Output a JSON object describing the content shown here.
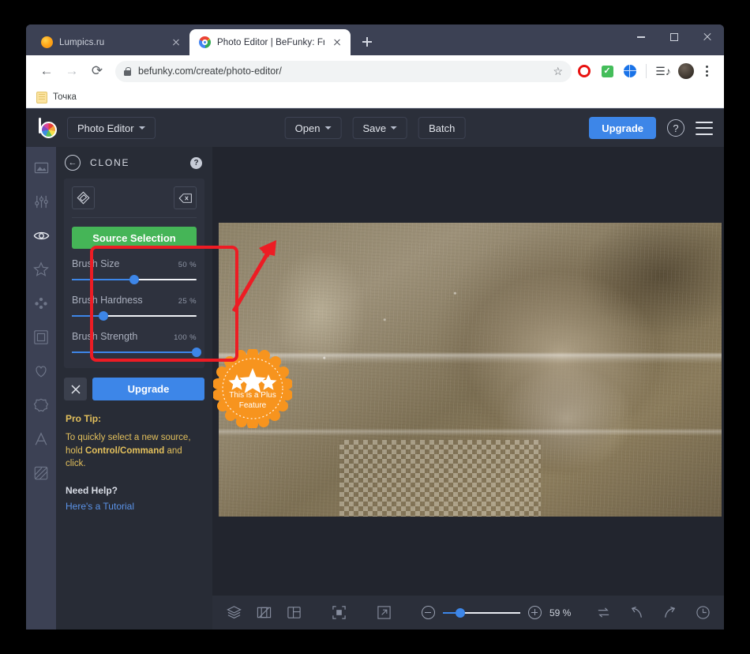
{
  "browser": {
    "tabs": [
      {
        "title": "Lumpics.ru",
        "favicon": "lumpics-favicon",
        "active": false
      },
      {
        "title": "Photo Editor | BeFunky: Free Onli",
        "favicon": "chrome-favicon",
        "active": true
      }
    ],
    "new_tab_label": "+",
    "window_controls": {
      "minimize": "minimize-icon",
      "maximize": "maximize-icon",
      "close": "close-icon"
    },
    "nav": {
      "back": "back-arrow-icon",
      "forward": "forward-arrow-icon",
      "reload": "reload-icon"
    },
    "address": {
      "url": "befunky.com/create/photo-editor/",
      "lock": "lock-icon",
      "bookmark": "star-icon"
    },
    "extensions": [
      "opera-extension-icon",
      "green-check-extension-icon",
      "blue-globe-extension-icon",
      "reading-list-icon"
    ],
    "profile": "avatar",
    "menu": "kebab-menu-icon",
    "bookmarks_bar": [
      {
        "label": "Точка",
        "icon": "folder-icon"
      }
    ]
  },
  "app": {
    "logo": "befunky-logo",
    "editor_menu": "Photo Editor",
    "center_buttons": [
      {
        "label": "Open",
        "has_caret": true
      },
      {
        "label": "Save",
        "has_caret": true
      },
      {
        "label": "Batch",
        "has_caret": false
      }
    ],
    "upgrade_label": "Upgrade",
    "help_icon": "question-mark-icon",
    "menu_icon": "hamburger-menu-icon"
  },
  "tool_rail": [
    {
      "name": "image-tool",
      "icon": "image-icon",
      "active": false
    },
    {
      "name": "edit-tool",
      "icon": "sliders-icon",
      "active": false
    },
    {
      "name": "touch-up-tool",
      "icon": "eye-icon",
      "active": true
    },
    {
      "name": "effects-tool",
      "icon": "star-icon",
      "active": false
    },
    {
      "name": "artsy-tool",
      "icon": "dots-cluster-icon",
      "active": false
    },
    {
      "name": "frames-tool",
      "icon": "frame-icon",
      "active": false
    },
    {
      "name": "overlays-tool",
      "icon": "heart-icon",
      "active": false
    },
    {
      "name": "graphics-tool",
      "icon": "badge-icon",
      "active": false
    },
    {
      "name": "text-tool",
      "icon": "letter-a-icon",
      "active": false
    },
    {
      "name": "textures-tool",
      "icon": "texture-icon",
      "active": false
    }
  ],
  "panel": {
    "back_icon": "back-circle-icon",
    "title": "CLONE",
    "help_icon": "question-mark-icon",
    "tools": [
      {
        "name": "clone-stamp-tool",
        "icon": "stamp-icon"
      },
      {
        "name": "eraser-tool",
        "icon": "eraser-icon"
      }
    ],
    "source_selection_label": "Source Selection",
    "sliders": [
      {
        "label": "Brush Size",
        "value": "50 %",
        "percent": 50
      },
      {
        "label": "Brush Hardness",
        "value": "25 %",
        "percent": 25
      },
      {
        "label": "Brush Strength",
        "value": "100 %",
        "percent": 100
      }
    ],
    "cancel_icon": "close-x-icon",
    "upgrade_label": "Upgrade",
    "pro_tip_title": "Pro Tip:",
    "pro_tip_line_a": "To quickly select a new source,",
    "pro_tip_bold": "Control/Command",
    "pro_tip_line_b_pre": "hold ",
    "pro_tip_line_b_post": " and click.",
    "need_help_title": "Need Help?",
    "tutorial_link": "Here's a Tutorial"
  },
  "canvas": {
    "badge": {
      "line1": "This is a Plus",
      "line2": "Feature",
      "stars": 3,
      "color": "#f7941e"
    },
    "annotation": {
      "box_color": "#ed1c24",
      "arrow": "red-arrow"
    }
  },
  "bottom_bar": {
    "left_icons": [
      "layers-icon",
      "compare-icon",
      "panels-icon"
    ],
    "view_icons": [
      "fit-to-screen-icon",
      "fullscreen-icon"
    ],
    "zoom": {
      "minus": "zoom-out-icon",
      "plus": "zoom-in-icon",
      "level": "59 %",
      "percent": 22
    },
    "right_icons": [
      "sync-icon",
      "undo-icon",
      "redo-icon",
      "history-icon"
    ]
  },
  "colors": {
    "accent_blue": "#3d86e8",
    "green": "#45b557",
    "orange": "#f7941e",
    "red": "#ed1c24",
    "tip_yellow": "#e3c05c"
  }
}
